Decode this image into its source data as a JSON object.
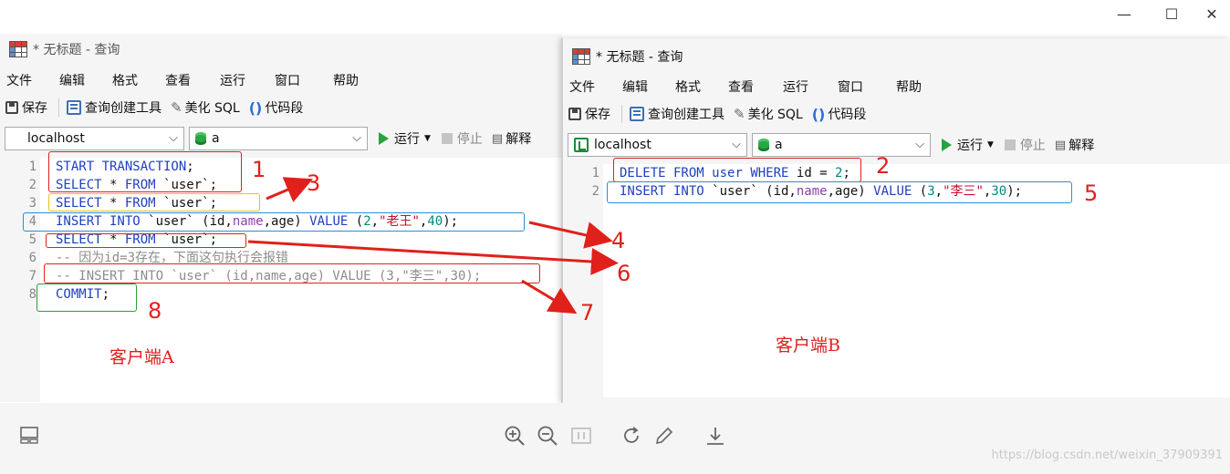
{
  "viewer": {
    "controls": {
      "minimize": "—",
      "maximize": "☐",
      "close": "✕"
    },
    "watermark": "https://blog.csdn.net/weixin_37909391"
  },
  "clientA": {
    "title": "* 无标题 - 查询",
    "menu": [
      "文件",
      "编辑",
      "格式",
      "查看",
      "运行",
      "窗口",
      "帮助"
    ],
    "toolbar": {
      "save": "保存",
      "query_builder": "查询创建工具",
      "beautify": "美化 SQL",
      "snippet": "代码段"
    },
    "connection": "localhost",
    "database": "a",
    "run": "运行",
    "stop": "停止",
    "explain": "解释",
    "lines": [
      {
        "n": "1",
        "tokens": [
          [
            "kw",
            "START TRANSACTION"
          ],
          [
            "txt",
            ";"
          ]
        ]
      },
      {
        "n": "2",
        "tokens": [
          [
            "kw",
            "SELECT"
          ],
          [
            "txt",
            " * "
          ],
          [
            "kw",
            "FROM"
          ],
          [
            "txt",
            " `user`;"
          ]
        ]
      },
      {
        "n": "3",
        "tokens": [
          [
            "kw",
            "SELECT"
          ],
          [
            "txt",
            " * "
          ],
          [
            "kw",
            "FROM"
          ],
          [
            "txt",
            " `user`;"
          ]
        ]
      },
      {
        "n": "4",
        "tokens": [
          [
            "kw",
            "INSERT INTO"
          ],
          [
            "txt",
            " `user` (id,"
          ],
          [
            "col",
            "name"
          ],
          [
            "txt",
            ",age) "
          ],
          [
            "kw",
            "VALUE"
          ],
          [
            "txt",
            " ("
          ],
          [
            "num",
            "2"
          ],
          [
            "txt",
            ","
          ],
          [
            "str",
            "\"老王\""
          ],
          [
            "txt",
            ","
          ],
          [
            "num",
            "40"
          ],
          [
            "txt",
            ");"
          ]
        ]
      },
      {
        "n": "5",
        "tokens": [
          [
            "kw",
            "SELECT"
          ],
          [
            "txt",
            " * "
          ],
          [
            "kw",
            "FROM"
          ],
          [
            "txt",
            " `user`;"
          ]
        ]
      },
      {
        "n": "6",
        "tokens": [
          [
            "cmt",
            "-- 因为id=3存在，下面这句执行会报错"
          ]
        ]
      },
      {
        "n": "7",
        "tokens": [
          [
            "cmt",
            "-- INSERT INTO `user` (id,name,age) VALUE (3,\"李三\",30);"
          ]
        ]
      },
      {
        "n": "8",
        "tokens": [
          [
            "kw",
            "COMMIT"
          ],
          [
            "txt",
            ";"
          ]
        ]
      }
    ],
    "label": "客户端A"
  },
  "clientB": {
    "title": "* 无标题 - 查询",
    "menu": [
      "文件",
      "编辑",
      "格式",
      "查看",
      "运行",
      "窗口",
      "帮助"
    ],
    "toolbar": {
      "save": "保存",
      "query_builder": "查询创建工具",
      "beautify": "美化 SQL",
      "snippet": "代码段"
    },
    "connection": "localhost",
    "database": "a",
    "run": "运行",
    "stop": "停止",
    "explain": "解释",
    "lines": [
      {
        "n": "1",
        "tokens": [
          [
            "kw",
            "DELETE FROM"
          ],
          [
            "txt",
            " "
          ],
          [
            "kw",
            "user"
          ],
          [
            "txt",
            " "
          ],
          [
            "kw",
            "WHERE"
          ],
          [
            "txt",
            " id = "
          ],
          [
            "num",
            "2"
          ],
          [
            "txt",
            ";"
          ]
        ]
      },
      {
        "n": "2",
        "tokens": [
          [
            "kw",
            "INSERT INTO"
          ],
          [
            "txt",
            " `user` (id,"
          ],
          [
            "col",
            "name"
          ],
          [
            "txt",
            ",age) "
          ],
          [
            "kw",
            "VALUE"
          ],
          [
            "txt",
            " ("
          ],
          [
            "num",
            "3"
          ],
          [
            "txt",
            ","
          ],
          [
            "str",
            "\"李三\""
          ],
          [
            "txt",
            ","
          ],
          [
            "num",
            "30"
          ],
          [
            "txt",
            ");"
          ]
        ]
      }
    ],
    "label": "客户端B"
  },
  "annotations": {
    "step_numbers": [
      "1",
      "2",
      "3",
      "4",
      "5",
      "6",
      "7",
      "8"
    ],
    "colors": {
      "red": "#e0201b",
      "yellow": "#f2c200",
      "blue": "#2a8fd6",
      "green": "#2e9e3a"
    }
  },
  "bottombar_icons": [
    "layout-icon",
    "zoom-in-icon",
    "zoom-out-icon",
    "actual-size-icon",
    "rotate-icon",
    "edit-icon",
    "download-icon"
  ]
}
